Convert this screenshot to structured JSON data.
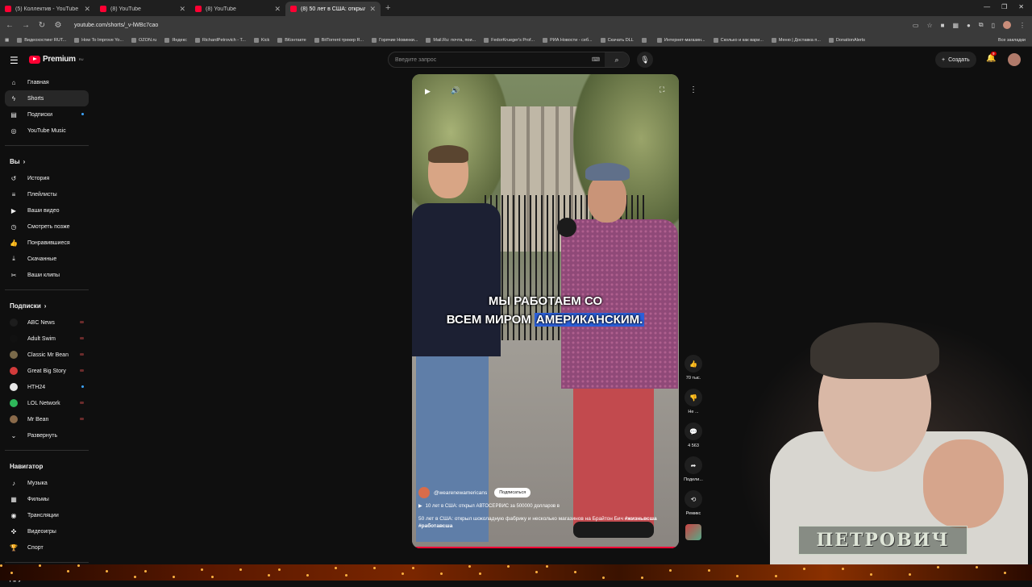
{
  "browser": {
    "tabs": [
      {
        "label": "(5) Коллектив - YouTube",
        "active": false
      },
      {
        "label": "(8) YouTube",
        "active": false
      },
      {
        "label": "(8) YouTube",
        "active": false
      },
      {
        "label": "(8) 50 лет в США: открыл",
        "active": true
      }
    ],
    "new_tab": "+",
    "url": "youtube.com/shorts/_v-lWBc7cao",
    "bookmarks": [
      "Видеохостинг RUT...",
      "How To Improve Yo...",
      "OZON.ru",
      "Яндекс",
      "RichardPetrovich - T...",
      "Kick",
      "ВКонтакте",
      "BitTorrent трекер R...",
      "Горячие Новинки...",
      "Mail.Ru: почта, пои...",
      "FedorKrueger's Prof...",
      "РИА Новости - себ...",
      "Скачать DLL",
      "",
      "Интернет-магазин...",
      "Сколько и как вари...",
      "Меню | Доставка п...",
      "DonationAlerts"
    ],
    "bookmarks_all": "Все закладки"
  },
  "header": {
    "logo_text": "Premium",
    "logo_region": "RU",
    "search_placeholder": "Введите запрос",
    "create_label": "Создать",
    "notif_count": "9"
  },
  "sidebar": {
    "main": [
      {
        "label": "Главная",
        "icon": "home-icon"
      },
      {
        "label": "Shorts",
        "icon": "shorts-icon",
        "active": true
      },
      {
        "label": "Подписки",
        "icon": "subscriptions-icon",
        "dot": true
      },
      {
        "label": "YouTube Music",
        "icon": "music-icon"
      }
    ],
    "you_header": "Вы",
    "you": [
      {
        "label": "История",
        "icon": "history-icon"
      },
      {
        "label": "Плейлисты",
        "icon": "playlist-icon"
      },
      {
        "label": "Ваши видео",
        "icon": "video-icon"
      },
      {
        "label": "Смотреть позже",
        "icon": "clock-icon"
      },
      {
        "label": "Понравившиеся",
        "icon": "like-icon"
      },
      {
        "label": "Скачанные",
        "icon": "download-icon"
      },
      {
        "label": "Ваши клипы",
        "icon": "scissors-icon"
      }
    ],
    "subs_header": "Подписки",
    "subs": [
      {
        "label": "ABC News",
        "color": "#1d1d1d",
        "live": true
      },
      {
        "label": "Adult Swim",
        "color": "#111111",
        "live": true
      },
      {
        "label": "Classic Mr Bean",
        "color": "#7a6a4a",
        "live": true
      },
      {
        "label": "Great Big Story",
        "color": "#d23b3b",
        "live": true
      },
      {
        "label": "HTH24",
        "color": "#e8e8e8",
        "dot": true
      },
      {
        "label": "LOL Network",
        "color": "#2fb75a",
        "live": true
      },
      {
        "label": "Mr Bean",
        "color": "#8a6a4a",
        "live": true
      }
    ],
    "expand_label": "Развернуть",
    "nav_header": "Навигатор",
    "nav": [
      {
        "label": "Музыка",
        "icon": "music-note-icon"
      },
      {
        "label": "Фильмы",
        "icon": "film-icon"
      },
      {
        "label": "Трансляции",
        "icon": "live-icon"
      },
      {
        "label": "Видеоигры",
        "icon": "gamepad-icon"
      },
      {
        "label": "Спорт",
        "icon": "trophy-icon"
      }
    ],
    "more_header": "Другие возможности"
  },
  "short": {
    "caption_line1": "МЫ РАБОТАЕМ СО",
    "caption_line2a": "ВСЕМ МИРОМ",
    "caption_line2b": "АМЕРИКАНСКИМ.",
    "channel": "@wearenewamericans",
    "subscribe_label": "Подписаться",
    "related": "10 лет в США: открыл АВТОСЕРВИС за 500000 долларов в",
    "title": "50 лет в США: открыл шоколадную фабрику и несколько магазинов на Брайтон Бич",
    "hashtags": "#жизньвсша #работавсша",
    "progress": 1.0
  },
  "actions": {
    "likes": "70 тыс.",
    "dislike": "Не ...",
    "comments": "4 563",
    "share": "Подели...",
    "remix": "Ремикс"
  },
  "watermark": "ПЕТРОВИЧ"
}
